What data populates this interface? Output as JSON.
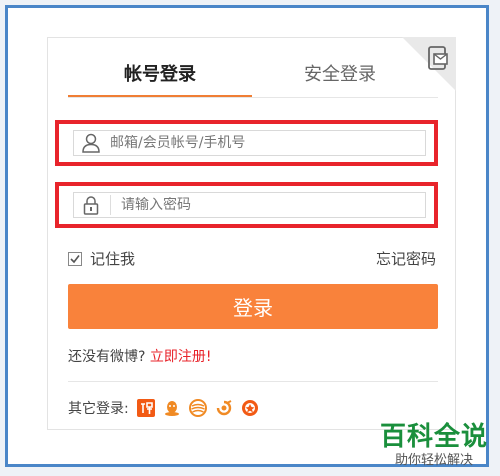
{
  "tabs": {
    "account": "帐号登录",
    "secure": "安全登录"
  },
  "fields": {
    "username_placeholder": "邮箱/会员帐号/手机号",
    "password_placeholder": "请输入密码"
  },
  "remember": {
    "label": "记住我",
    "checked": true
  },
  "forgot": "忘记密码",
  "login_button": "登录",
  "signup": {
    "prompt": "还没有微博?",
    "link": "立即注册!"
  },
  "other_login": {
    "label": "其它登录:",
    "icons": [
      "taobao-icon",
      "qq-icon",
      "tianyi-icon",
      "wangyi-icon",
      "renren-icon"
    ]
  },
  "watermark": {
    "title": "百科全说",
    "subtitle": "助你轻松解决"
  },
  "colors": {
    "accent": "#f9823b",
    "highlight": "#e8242b",
    "frame": "#4a86c8"
  }
}
